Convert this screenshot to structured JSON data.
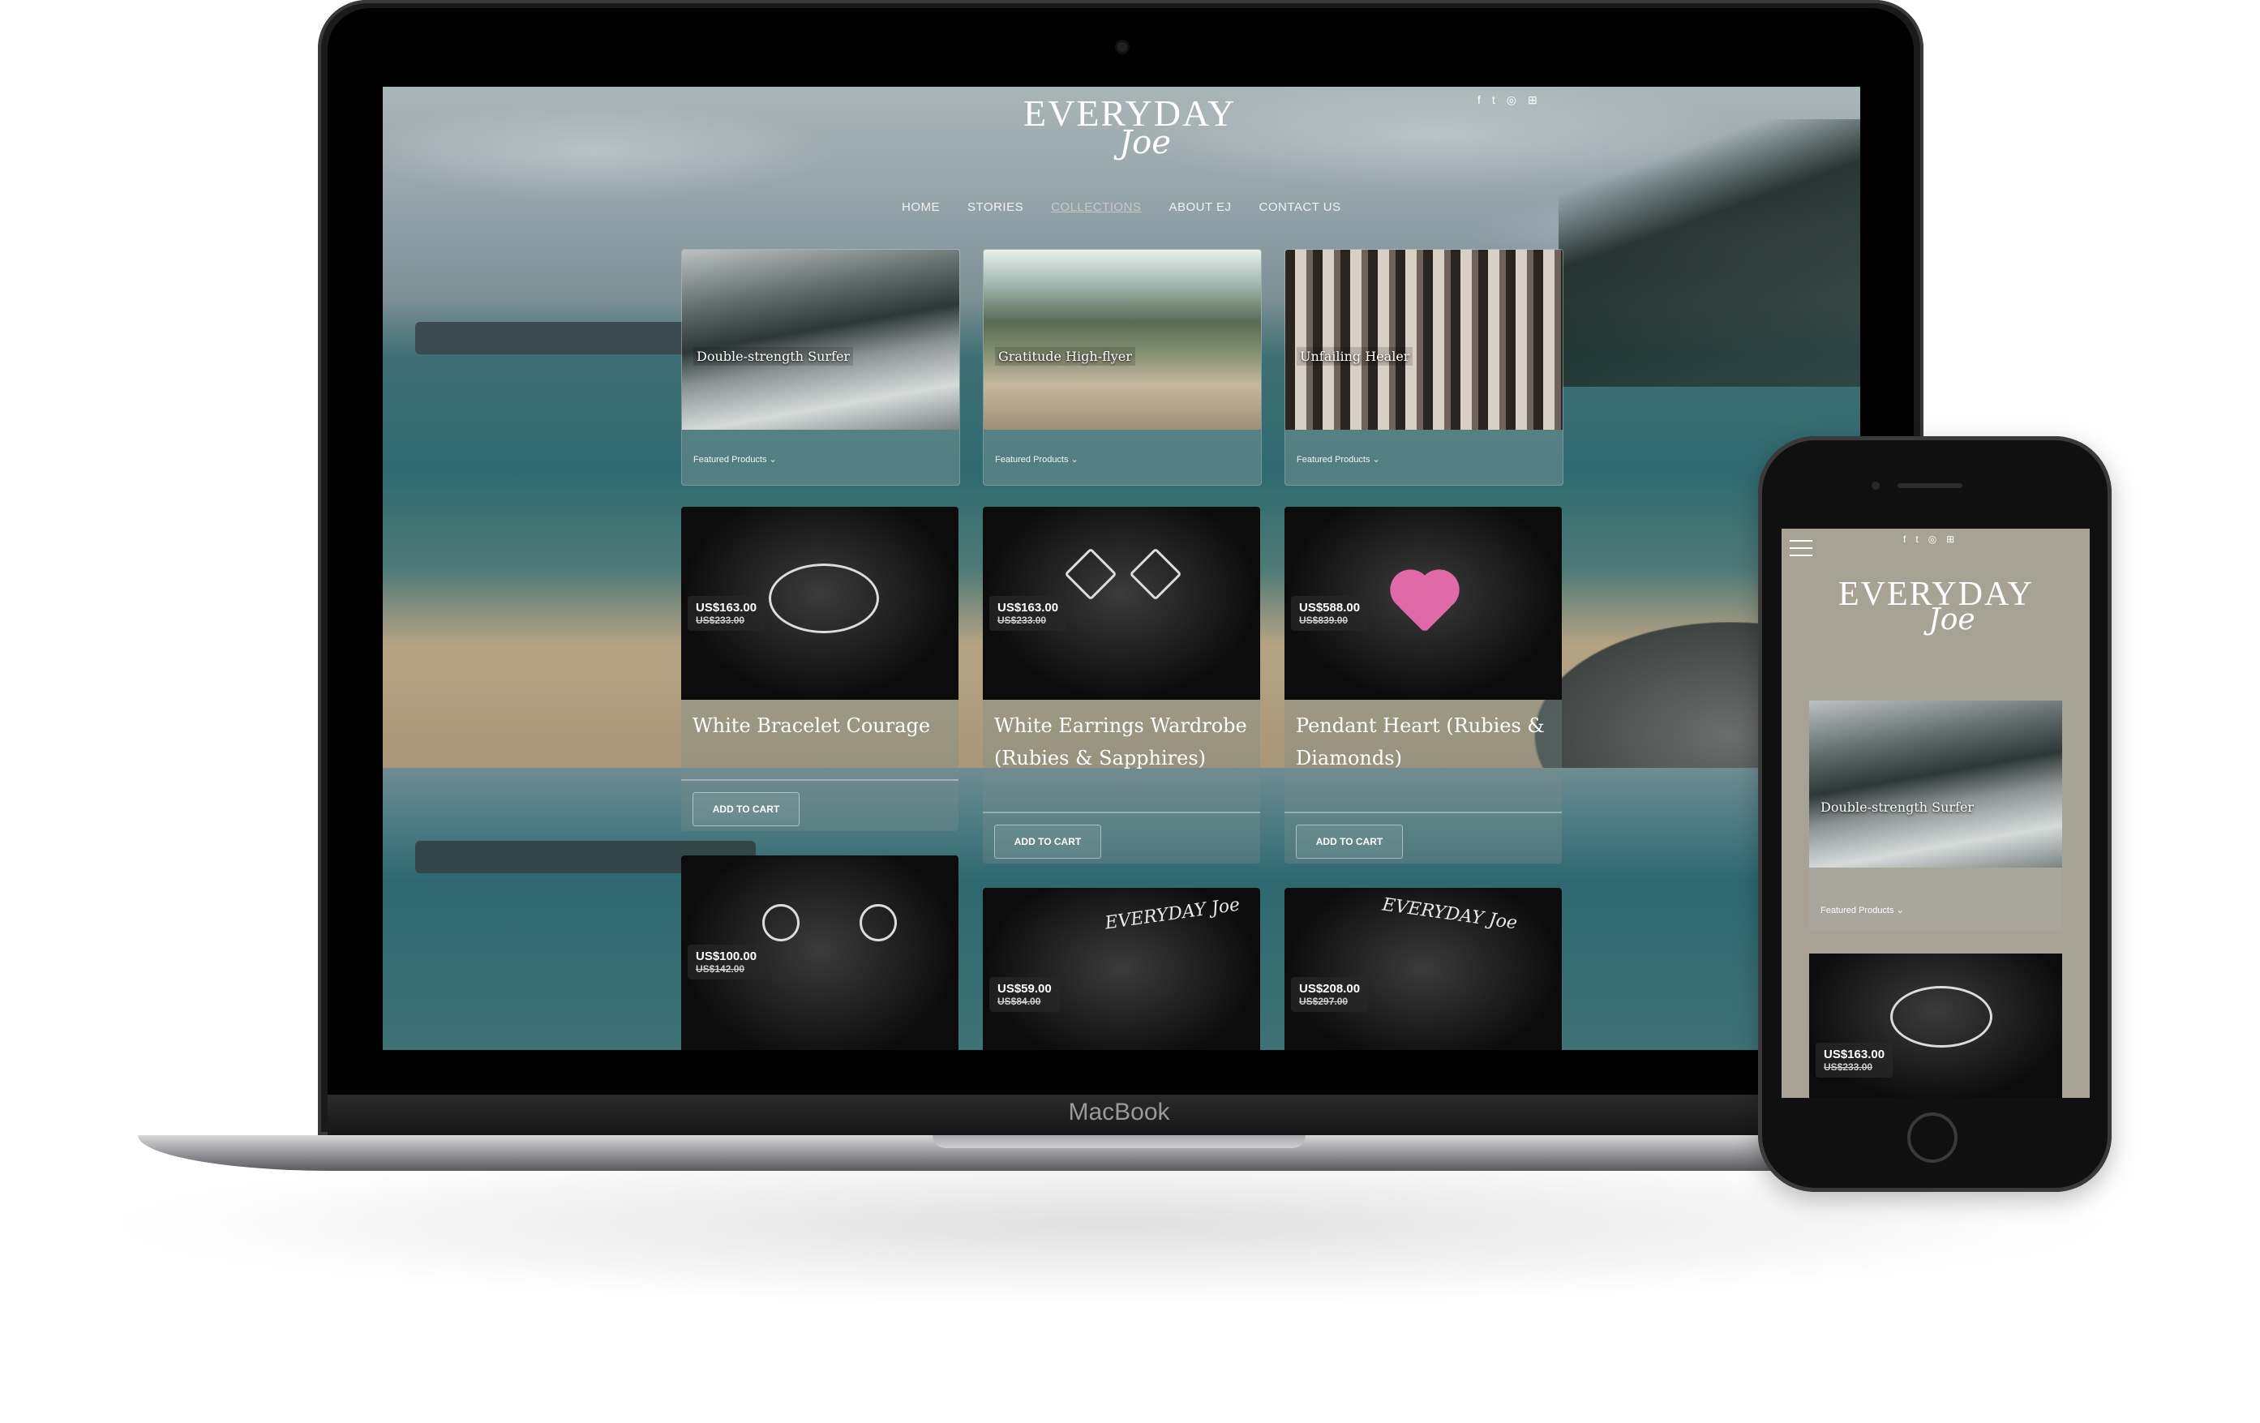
{
  "laptop": {
    "brand": "MacBook"
  },
  "site": {
    "logo_word": "EVERYDAY",
    "logo_script": "Joe",
    "social_icons": [
      "facebook-icon",
      "twitter-icon",
      "instagram-icon",
      "cart-icon"
    ],
    "social_glyphs": [
      "f",
      "t",
      "◎",
      "⊞"
    ],
    "nav": [
      {
        "label": "HOME",
        "active": false
      },
      {
        "label": "STORIES",
        "active": false
      },
      {
        "label": "COLLECTIONS",
        "active": true
      },
      {
        "label": "ABOUT EJ",
        "active": false
      },
      {
        "label": "CONTACT US",
        "active": false
      }
    ],
    "stories": [
      {
        "title": "Double-strength Surfer",
        "category": "Featured Products ⌄"
      },
      {
        "title": "Gratitude High-flyer",
        "category": "Featured Products ⌄"
      },
      {
        "title": "Unfailing Healer",
        "category": "Featured Products ⌄"
      }
    ],
    "products": [
      {
        "price": "US$163.00",
        "old_price": "US$233.00",
        "name": "White Bracelet Courage",
        "button": "ADD TO CART"
      },
      {
        "price": "US$163.00",
        "old_price": "US$233.00",
        "name": "White Earrings Wardrobe (Rubies & Sapphires)",
        "button": "ADD TO CART"
      },
      {
        "price": "US$588.00",
        "old_price": "US$839.00",
        "name": "Pendant Heart (Rubies & Diamonds)",
        "button": "ADD TO CART"
      },
      {
        "price": "US$100.00",
        "old_price": "US$142.00"
      },
      {
        "price": "US$59.00",
        "old_price": "US$84.00"
      },
      {
        "price": "US$208.00",
        "old_price": "US$297.00"
      }
    ],
    "box_logo": "EVERYDAY Joe"
  },
  "phone": {
    "social_glyphs": [
      "f",
      "t",
      "◎",
      "⊞"
    ],
    "logo_word": "EVERYDAY",
    "logo_script": "Joe",
    "story_title": "Double-strength Surfer",
    "story_category": "Featured Products ⌄",
    "product_price": "US$163.00",
    "product_old_price": "US$233.00"
  }
}
